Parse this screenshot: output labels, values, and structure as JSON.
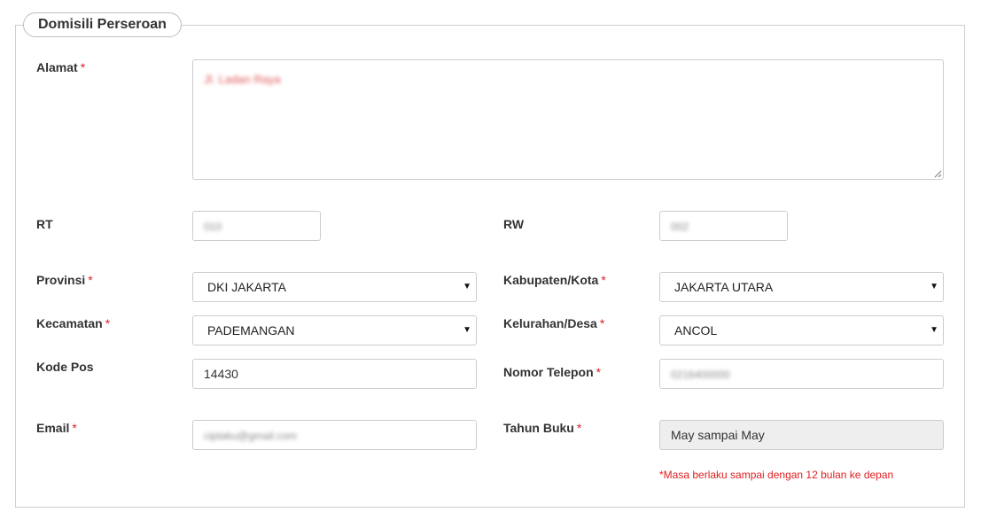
{
  "section": {
    "title": "Domisili Perseroan"
  },
  "required_mark": "*",
  "fields": {
    "alamat": {
      "label": "Alamat",
      "value": "Jl. Ladan Raya"
    },
    "rt": {
      "label": "RT",
      "value": "010"
    },
    "rw": {
      "label": "RW",
      "value": "002"
    },
    "provinsi": {
      "label": "Provinsi",
      "value": "DKI JAKARTA"
    },
    "kabupaten": {
      "label": "Kabupaten/Kota",
      "value": "JAKARTA UTARA"
    },
    "kecamatan": {
      "label": "Kecamatan",
      "value": "PADEMANGAN"
    },
    "kelurahan": {
      "label": "Kelurahan/Desa",
      "value": "ANCOL"
    },
    "kode_pos": {
      "label": "Kode Pos",
      "value": "14430"
    },
    "telepon": {
      "label": "Nomor Telepon",
      "value": "0216400000"
    },
    "email": {
      "label": "Email",
      "value": "ciptaku@gmail.com"
    },
    "tahun_buku": {
      "label": "Tahun Buku",
      "value": "May sampai May"
    }
  },
  "note": "*Masa berlaku sampai dengan 12 bulan ke depan",
  "icons": {
    "dropdown": "▼",
    "resize": "resize-grip-icon"
  },
  "colors": {
    "required": "#e02020",
    "border": "#cccccc",
    "readonly_bg": "#eeeeee"
  }
}
